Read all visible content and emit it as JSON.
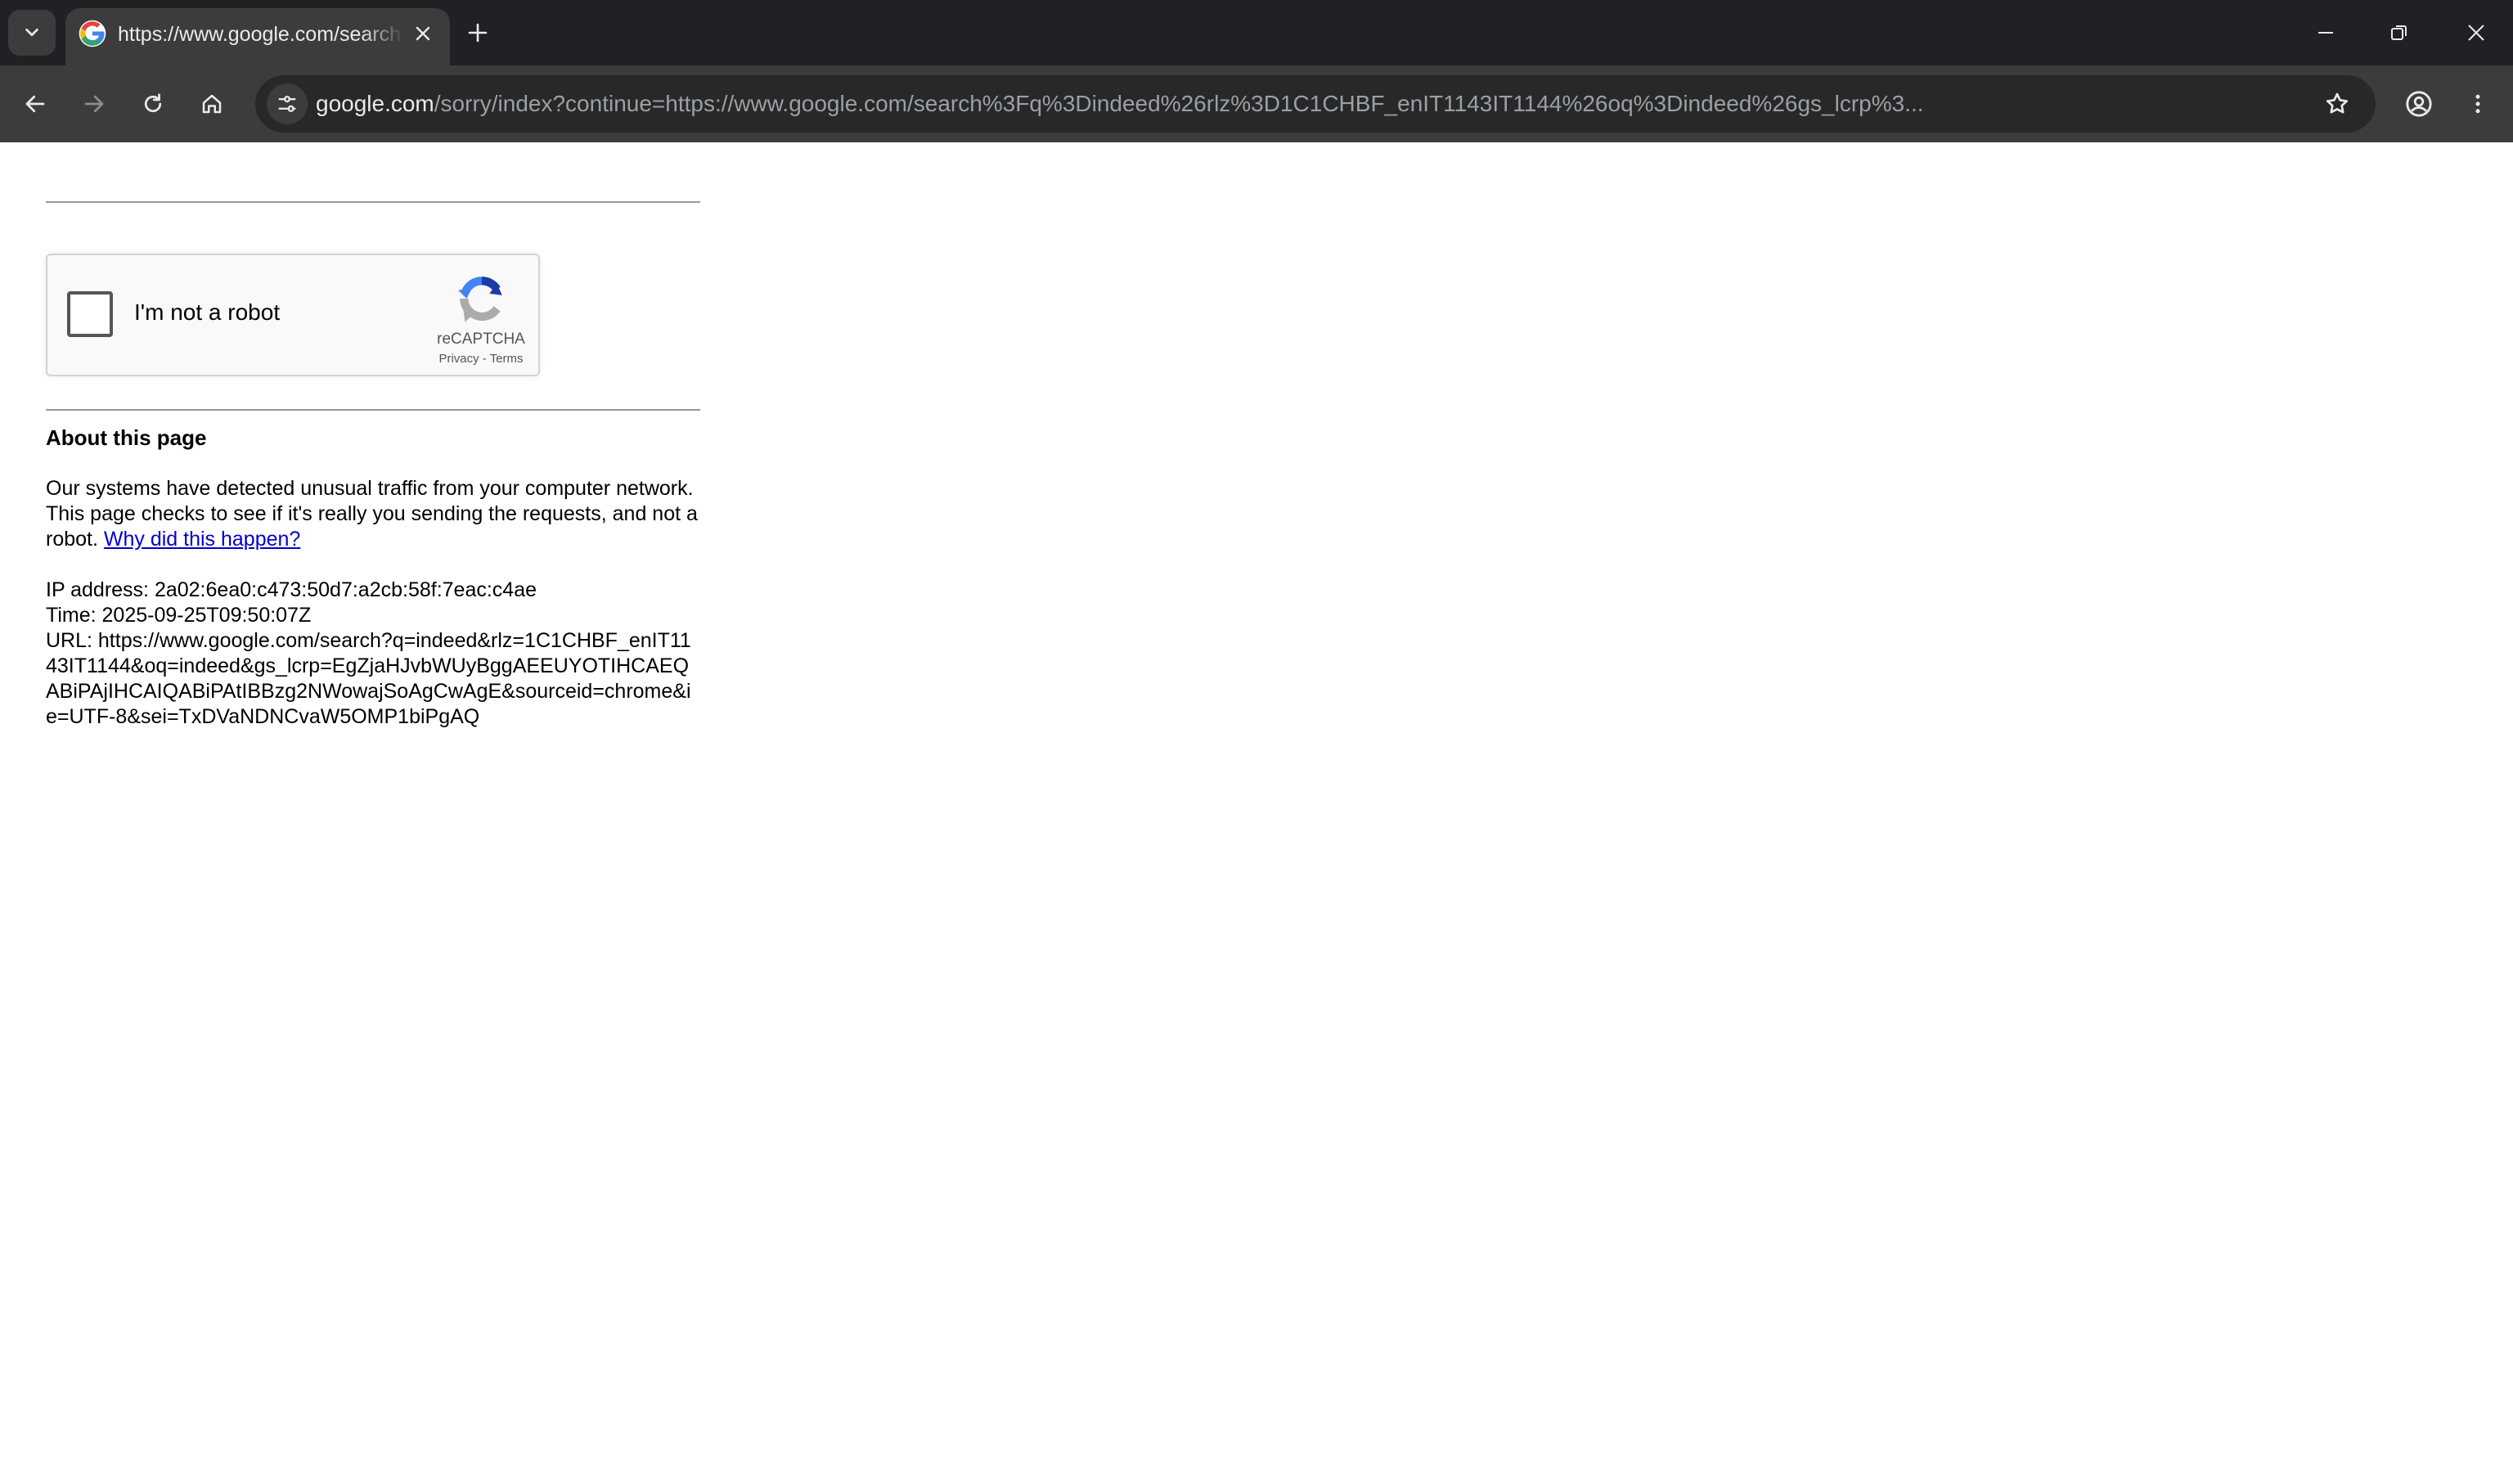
{
  "browser": {
    "tab": {
      "title": "https://www.google.com/search?q=indeed"
    },
    "omnibox": {
      "host": "google.com",
      "path": "/sorry/index?continue=https://www.google.com/search%3Fq%3Dindeed%26rlz%3D1C1CHBF_enIT1143IT1144%26oq%3Dindeed%26gs_lcrp%3..."
    },
    "icons": {
      "tab_search": "chevron-down-icon",
      "favicon": "google-g-icon",
      "tab_close": "close-icon",
      "new_tab": "plus-icon",
      "minimize": "minimize-icon",
      "restore": "restore-icon",
      "close_window": "close-icon",
      "back": "back-arrow-icon",
      "forward": "forward-arrow-icon",
      "reload": "reload-icon",
      "home": "home-icon",
      "site_info": "tune-icon",
      "bookmark": "star-icon",
      "profile": "account-circle-icon",
      "menu": "kebab-menu-icon"
    }
  },
  "recaptcha": {
    "label": "I'm not a robot",
    "brand": "reCAPTCHA",
    "privacy": "Privacy",
    "separator": " - ",
    "terms": "Terms"
  },
  "about": {
    "title": "About this page",
    "text": "Our systems have detected unusual traffic from your computer network. This page checks to see if it's really you sending the requests, and not a robot.",
    "link": "Why did this happen?"
  },
  "info": {
    "ip": "IP address: 2a02:6ea0:c473:50d7:a2cb:58f:7eac:c4ae",
    "time": "Time: 2025-09-25T09:50:07Z",
    "url": "URL: https://www.google.com/search?q=indeed&rlz=1C1CHBF_enIT1143IT1144&oq=indeed&gs_lcrp=EgZjaHJvbWUyBggAEEUYOTIHCAEQABiPAjIHCAIQABiPAtIBBzg2NWowajSoAgCwAgE&sourceid=chrome&ie=UTF-8&sei=TxDVaNDNCvaW5OMP1biPgAQ"
  },
  "colors": {
    "chrome_dark": "#202124",
    "toolbar": "#3c3c3c",
    "link": "#0000cc"
  }
}
